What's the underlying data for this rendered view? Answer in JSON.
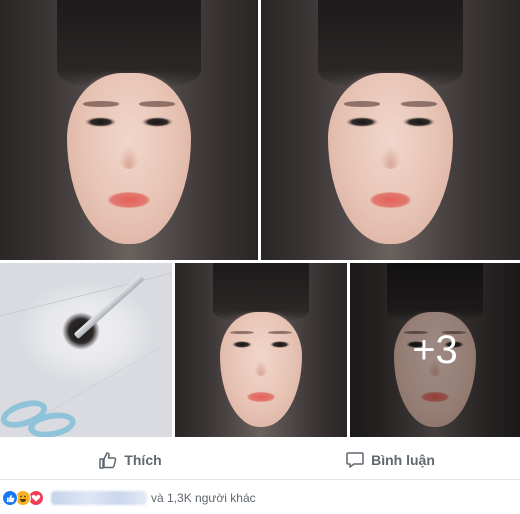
{
  "photos": {
    "more_count": "+3"
  },
  "actions": {
    "like_label": "Thích",
    "comment_label": "Bình luận"
  },
  "reactions": {
    "types": [
      "like",
      "haha",
      "love"
    ],
    "others_text": "và 1,3K người khác"
  },
  "colors": {
    "like_blue": "#1877f2",
    "haha_yellow": "#f7b125",
    "love_red": "#f33e58",
    "action_text": "#606770"
  }
}
